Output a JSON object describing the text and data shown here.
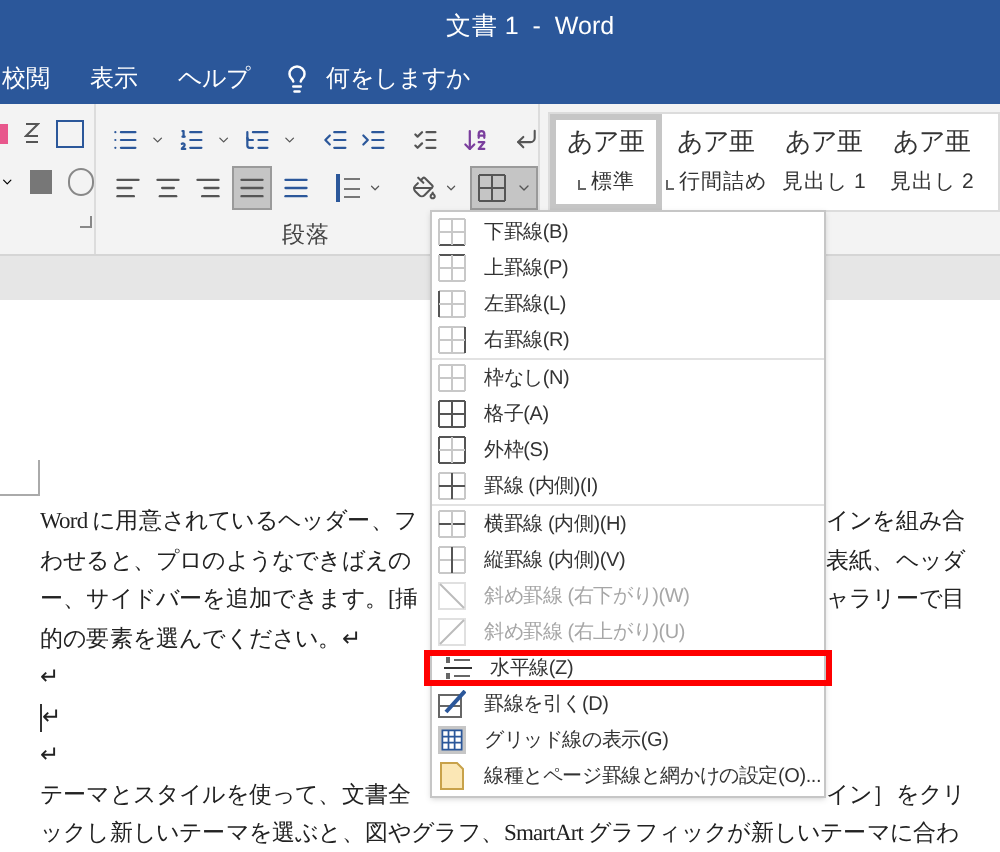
{
  "window": {
    "title": "文書 1  -  Word"
  },
  "tabs": [
    {
      "label": "校閲"
    },
    {
      "label": "表示"
    },
    {
      "label": "ヘルプ"
    }
  ],
  "tell_me": {
    "label": "何をしますか"
  },
  "paragraph_group": {
    "label": "段落",
    "alignment": [
      {
        "kind": "left",
        "selected": false
      },
      {
        "kind": "center",
        "selected": false
      },
      {
        "kind": "right",
        "selected": false
      },
      {
        "kind": "justify",
        "selected": true
      },
      {
        "kind": "distribute",
        "selected": false
      }
    ],
    "borders_button": {
      "selected": true
    }
  },
  "styles": [
    {
      "sample": "あア亜",
      "name": "標準",
      "linked": true,
      "selected": true
    },
    {
      "sample": "あア亜",
      "name": "行間詰め",
      "linked": true,
      "selected": false
    },
    {
      "sample": "あア亜",
      "name": "見出し 1",
      "linked": false,
      "selected": false
    },
    {
      "sample": "あア亜",
      "name": "見出し 2",
      "linked": false,
      "selected": false
    }
  ],
  "menu": {
    "sections": [
      [
        {
          "kind": "bottom",
          "label": "下罫線(B)",
          "disabled": false,
          "highlighted": false
        },
        {
          "kind": "top",
          "label": "上罫線(P)",
          "disabled": false,
          "highlighted": false
        },
        {
          "kind": "left",
          "label": "左罫線(L)",
          "disabled": false,
          "highlighted": false
        },
        {
          "kind": "right",
          "label": "右罫線(R)",
          "disabled": false,
          "highlighted": false
        }
      ],
      [
        {
          "kind": "none",
          "label": "枠なし(N)",
          "disabled": false,
          "highlighted": false
        },
        {
          "kind": "all",
          "label": "格子(A)",
          "disabled": false,
          "highlighted": false
        },
        {
          "kind": "outside",
          "label": "外枠(S)",
          "disabled": false,
          "highlighted": false
        },
        {
          "kind": "inside",
          "label": "罫線 (内側)(I)",
          "disabled": false,
          "highlighted": false
        }
      ],
      [
        {
          "kind": "inside_h",
          "label": "横罫線 (内側)(H)",
          "disabled": false,
          "highlighted": false
        },
        {
          "kind": "inside_v",
          "label": "縦罫線 (内側)(V)",
          "disabled": false,
          "highlighted": false
        },
        {
          "kind": "diag_down",
          "label": "斜め罫線 (右下がり)(W)",
          "disabled": true,
          "highlighted": false
        },
        {
          "kind": "diag_up",
          "label": "斜め罫線 (右上がり)(U)",
          "disabled": true,
          "highlighted": false
        },
        {
          "kind": "hline",
          "label": "水平線(Z)",
          "disabled": false,
          "highlighted": true
        },
        {
          "kind": "draw",
          "label": "罫線を引く(D)",
          "disabled": false,
          "highlighted": false
        },
        {
          "kind": "gridlines",
          "label": "グリッド線の表示(G)",
          "disabled": false,
          "highlighted": false
        },
        {
          "kind": "settings",
          "label": "線種とページ罫線と網かけの設定(O)...",
          "disabled": false,
          "highlighted": false
        }
      ]
    ]
  },
  "document": {
    "lines": [
      {
        "left": "Word に用意されているヘッダー、フ",
        "right": "インを組み合",
        "cursor": false
      },
      {
        "left": "わせると、プロのようなできばえの",
        "right": "表紙、ヘッダ",
        "cursor": false
      },
      {
        "left": "ー、サイドバーを追加できます。[挿",
        "right": "ャラリーで目",
        "cursor": false
      },
      {
        "left": "的の要素を選んでください。↵",
        "cursor": false
      },
      {
        "left": "↵",
        "cursor": false
      },
      {
        "left": "↵",
        "cursor": true
      },
      {
        "left": "↵",
        "cursor": false
      },
      {
        "left": "テーマとスタイルを使って、文書全",
        "right": "イン］をクリ",
        "cursor": false
      },
      {
        "left": "ックし新しいテーマを選ぶと、図やグラフ、SmartArt グラフィックが新しいテーマに合わ",
        "cursor": false
      }
    ]
  }
}
